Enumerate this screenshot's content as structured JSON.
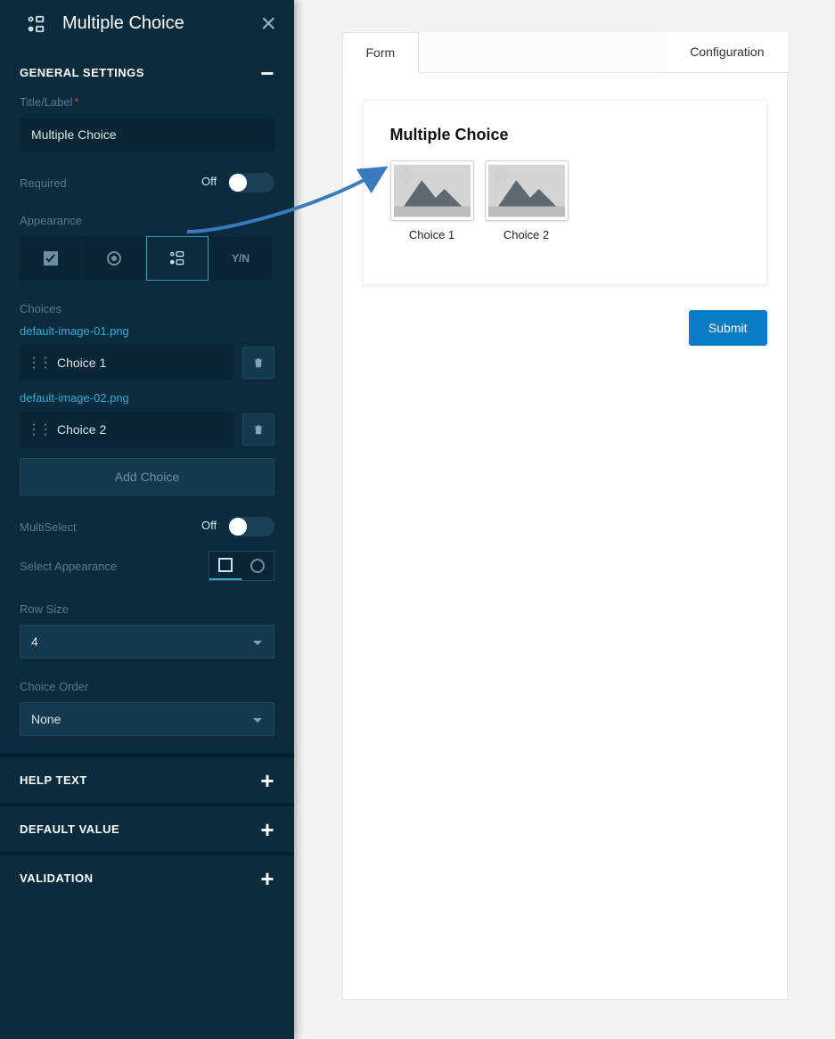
{
  "panel": {
    "title": "Multiple Choice",
    "sections": {
      "general": {
        "label": "GENERAL SETTINGS",
        "expanded": true
      },
      "help": {
        "label": "HELP TEXT",
        "expanded": false
      },
      "default": {
        "label": "DEFAULT VALUE",
        "expanded": false
      },
      "validation": {
        "label": "VALIDATION",
        "expanded": false
      }
    },
    "title_field": {
      "label": "Title/Label",
      "value": "Multiple Choice",
      "required": true
    },
    "required_toggle": {
      "label": "Required",
      "state": "Off"
    },
    "appearance_label": "Appearance",
    "appearance_opts": {
      "yn": "Y/N"
    },
    "choices_label": "Choices",
    "choices": [
      {
        "file": "default-image-01.png",
        "label": "Choice 1"
      },
      {
        "file": "default-image-02.png",
        "label": "Choice 2"
      }
    ],
    "add_choice_label": "Add Choice",
    "multiselect": {
      "label": "MultiSelect",
      "state": "Off"
    },
    "select_appearance_label": "Select Appearance",
    "row_size": {
      "label": "Row Size",
      "value": "4"
    },
    "choice_order": {
      "label": "Choice Order",
      "value": "None"
    }
  },
  "main": {
    "tabs": {
      "form": "Form",
      "config": "Configuration"
    },
    "form_title": "Multiple Choice",
    "choices": [
      {
        "label": "Choice 1"
      },
      {
        "label": "Choice 2"
      }
    ],
    "submit": "Submit"
  }
}
